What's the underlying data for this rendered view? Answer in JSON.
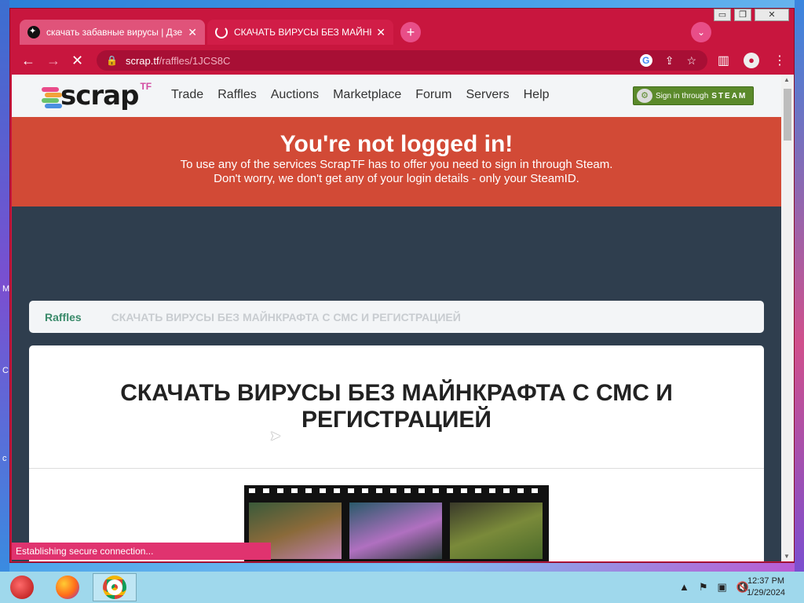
{
  "desktop": {
    "left_letters": [
      "M",
      "C",
      "c"
    ]
  },
  "browser": {
    "tabs": [
      {
        "title": "скачать забавные вирусы | Дзен",
        "close": "✕",
        "active": false
      },
      {
        "title": "СКАЧАТЬ ВИРУСЫ БЕЗ МАЙНКРАФТА",
        "close": "✕",
        "active": true
      }
    ],
    "new_tab": "+",
    "url_host": "scrap.tf",
    "url_path": "/raffles/1JCS8C",
    "window_buttons": {
      "minimize": "▭",
      "maximize": "❐",
      "close": "✕"
    },
    "status_text": "Establishing secure connection..."
  },
  "site": {
    "logo_word": "scrap",
    "logo_tf": "TF",
    "nav": [
      "Trade",
      "Raffles",
      "Auctions",
      "Marketplace",
      "Forum",
      "Servers",
      "Help"
    ],
    "steam_button": {
      "prefix": "Sign in through",
      "brand": "STEAM"
    },
    "alert": {
      "title": "You're not logged in!",
      "line1": "To use any of the services ScrapTF has to offer you need to sign in through Steam.",
      "line2": "Don't worry, we don't get any of your login details - only your SteamID."
    },
    "breadcrumb": {
      "link": "Raffles",
      "current": "СКАЧАТЬ ВИРУСЫ БЕЗ МАЙНКРАФТА С СМС И РЕГИСТРАЦИЕЙ"
    },
    "raffle_title": "СКАЧАТЬ ВИРУСЫ БЕЗ МАЙНКРАФТА С СМС И РЕГИСТРАЦИЕЙ"
  },
  "taskbar": {
    "time": "12:37 PM",
    "date": "1/29/2024"
  },
  "colors": {
    "chrome_theme": "#c8163e",
    "alert_bg": "#d24a36",
    "page_bg": "#2f3e4e",
    "steam_green": "#5b8a2b",
    "breadcrumb_link": "#3a8a6a"
  }
}
